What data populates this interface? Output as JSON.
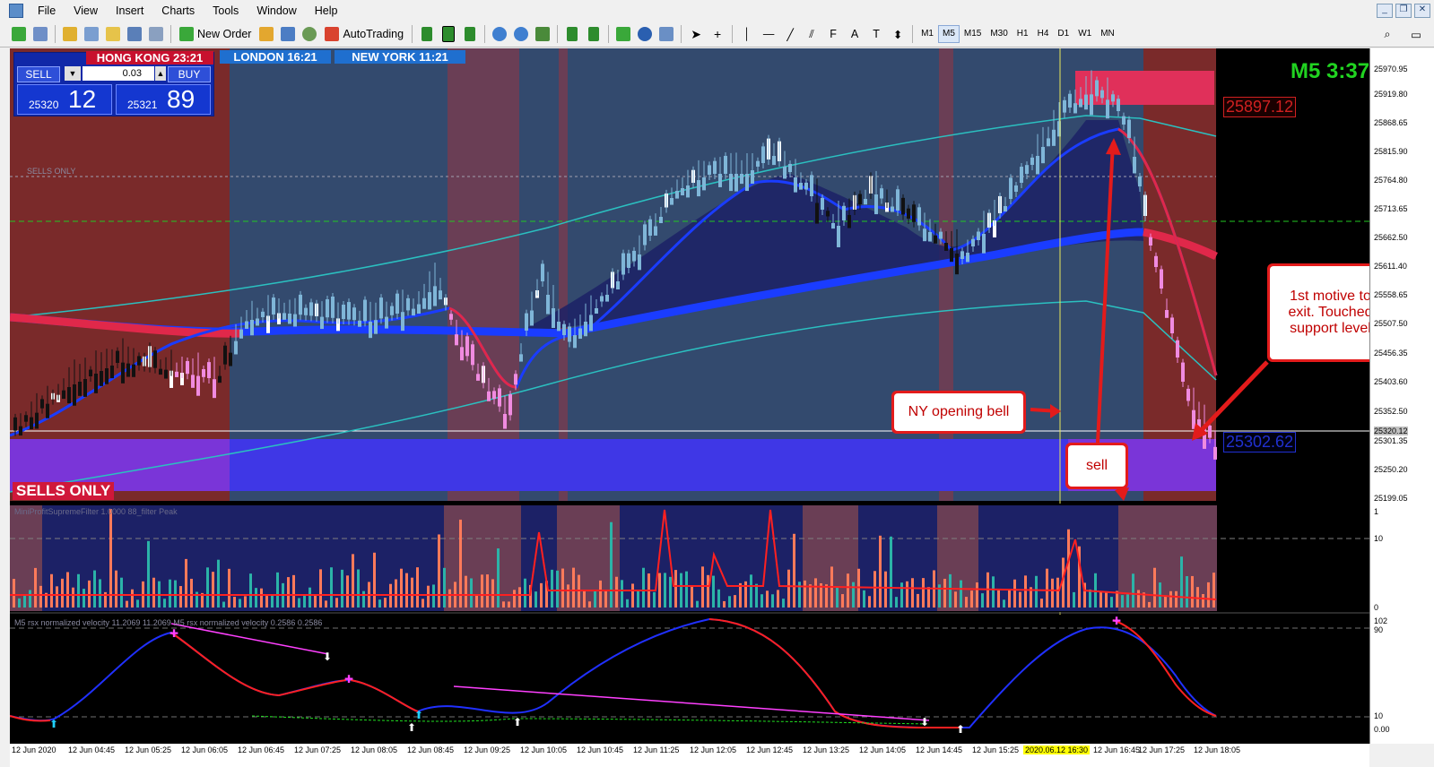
{
  "menu": [
    "File",
    "View",
    "Insert",
    "Charts",
    "Tools",
    "Window",
    "Help"
  ],
  "toolbar": {
    "new_order": "New Order",
    "autotrading": "AutoTrading"
  },
  "timeframes": [
    "M1",
    "M5",
    "M15",
    "M30",
    "H1",
    "H4",
    "D1",
    "W1",
    "MN"
  ],
  "active_timeframe": "M5",
  "trade_panel": {
    "sell_label": "SELL",
    "buy_label": "BUY",
    "lot": "0.03",
    "sell_small": "25320",
    "sell_big": "12",
    "buy_small": "25321",
    "buy_big": "89"
  },
  "sessions": [
    {
      "label": "HONG KONG 23:21",
      "color": "#c8102e"
    },
    {
      "label": "LONDON  16:21",
      "color": "#1f6fcf"
    },
    {
      "label": "NEW YORK  11:21",
      "color": "#1f6fcf"
    }
  ],
  "sells_only": "SELLS ONLY",
  "timer": "M5 3:37",
  "price_upper": "25897.12",
  "price_lower": "25302.62",
  "sell_line_label": "SELLS ONLY",
  "callouts": {
    "ny_open": "NY opening bell",
    "sell": "sell",
    "exit": "1st motive to exit. Touched support level"
  },
  "subwindow1_label": "MiniProfitSupremeFilter 1.0000  88_filter  Peak",
  "subwindow2_label": "M5 rsx normalized velocity 11.2069 11.2069  M5 rsx normalized velocity 0.2586 0.2586",
  "price_axis": [
    "25970.95",
    "25919.80",
    "25868.65",
    "25815.90",
    "25764.80",
    "25713.65",
    "25662.50",
    "25611.40",
    "25558.65",
    "25507.50",
    "25456.35",
    "25403.60",
    "25352.50",
    "25320.12",
    "25301.35",
    "25250.20",
    "25199.05"
  ],
  "sub1_axis": [
    "1",
    "10",
    "0"
  ],
  "sub2_axis": [
    "102",
    "90",
    "10",
    "0.00"
  ],
  "time_axis": [
    "12 Jun 2020",
    "12 Jun 04:45",
    "12 Jun 05:25",
    "12 Jun 06:05",
    "12 Jun 06:45",
    "12 Jun 07:25",
    "12 Jun 08:05",
    "12 Jun 08:45",
    "12 Jun 09:25",
    "12 Jun 10:05",
    "12 Jun 10:45",
    "12 Jun 11:25",
    "12 Jun 12:05",
    "12 Jun 12:45",
    "12 Jun 13:25",
    "12 Jun 14:05",
    "12 Jun 14:45",
    "12 Jun 15:25",
    "2020.06.12 16:30",
    "12 Jun 16:45",
    "12 Jun 17:25",
    "12 Jun 18:05"
  ]
}
